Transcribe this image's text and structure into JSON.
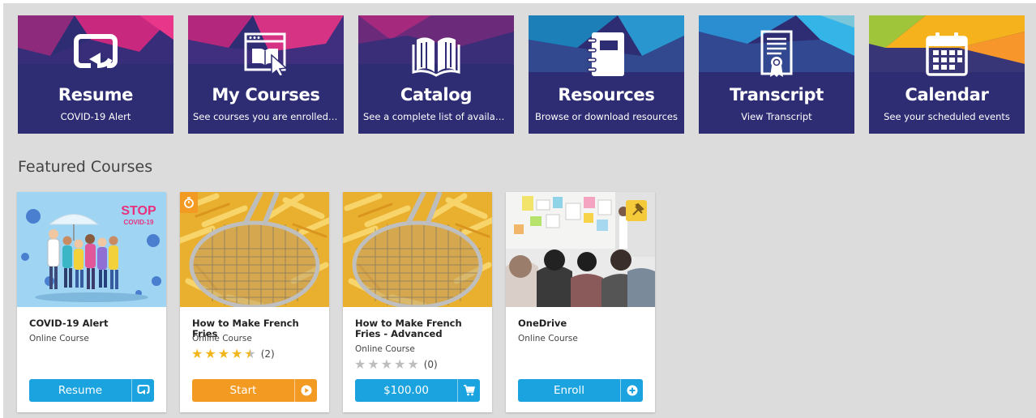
{
  "colors": {
    "tile_bg": "#2e2d74",
    "page_bg": "#dcdcdc",
    "button_blue": "#1aa3de",
    "button_orange": "#f39a22",
    "star_gold": "#f2b61d",
    "star_grey": "#bdbdbd"
  },
  "tiles": [
    {
      "title": "Resume",
      "subtitle": "COVID-19 Alert",
      "icon": "resume-icon"
    },
    {
      "title": "My Courses",
      "subtitle": "See courses you are enrolled in",
      "icon": "my-courses-icon"
    },
    {
      "title": "Catalog",
      "subtitle": "See a complete list of available c...",
      "icon": "book-icon"
    },
    {
      "title": "Resources",
      "subtitle": "Browse or download resources",
      "icon": "notebook-icon"
    },
    {
      "title": "Transcript",
      "subtitle": "View Transcript",
      "icon": "certificate-icon"
    },
    {
      "title": "Calendar",
      "subtitle": "See your scheduled events",
      "icon": "calendar-icon"
    }
  ],
  "featured": {
    "heading": "Featured Courses",
    "courses": [
      {
        "name": "COVID-19 Alert",
        "type": "Online Course",
        "button": "Resume",
        "button_icon": "resume-icon",
        "thumb_text": [
          "STOP",
          "COVID-19"
        ]
      },
      {
        "name": "How to Make French Fries",
        "type": "Online Course",
        "rating": 4.5,
        "rating_count": "(2)",
        "button": "Start",
        "button_icon": "play-icon",
        "badge": "timer-icon"
      },
      {
        "name": "How to Make French Fries - Advanced",
        "type": "Online Course",
        "rating": 0,
        "rating_count": "(0)",
        "button": "$100.00",
        "button_icon": "cart-icon"
      },
      {
        "name": "OneDrive",
        "type": "Online Course",
        "button": "Enroll",
        "button_icon": "plus-circle-icon",
        "badge": "pin-icon"
      }
    ]
  }
}
